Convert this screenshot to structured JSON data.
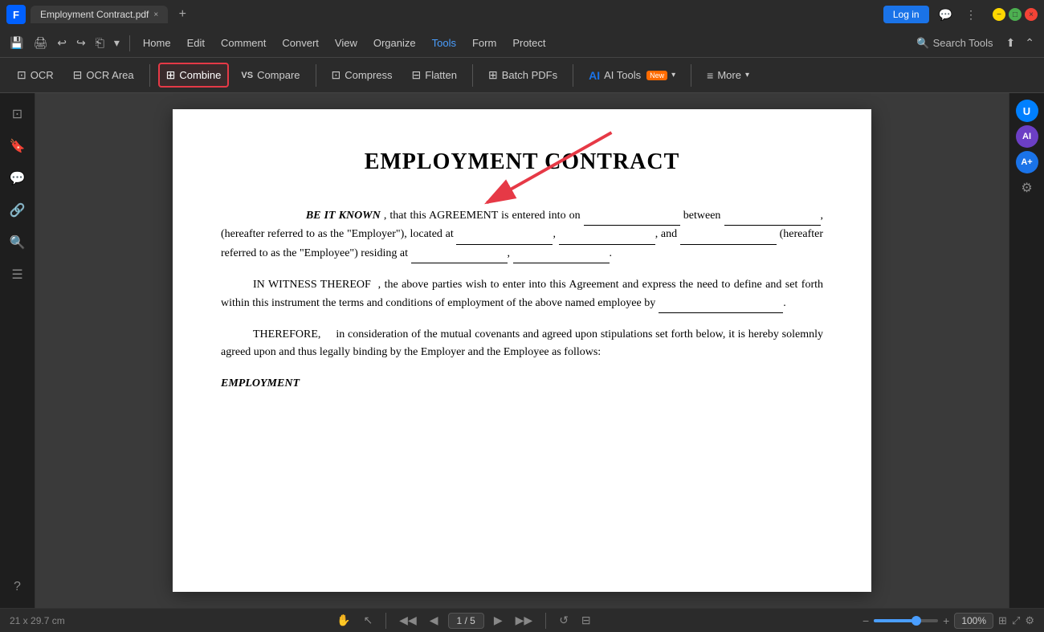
{
  "titleBar": {
    "appLogo": "F",
    "tab": {
      "label": "Employment Contract.pdf",
      "closeBtn": "×"
    },
    "addTabBtn": "+",
    "loginBtn": "Log in",
    "moreMenuIcon": "⋮",
    "minimizeIcon": "—",
    "maximizeIcon": "□",
    "closeIcon": "×"
  },
  "menuBar": {
    "saveIcon": "💾",
    "printIcon": "🖨",
    "undoIcon": "↩",
    "redoIcon": "↪",
    "shareIcon": "⎗",
    "dropdownIcon": "▾",
    "items": [
      "Home",
      "Edit",
      "Comment",
      "Convert",
      "View",
      "Organize",
      "Tools",
      "Form",
      "Protect"
    ],
    "activeItem": "Tools",
    "searchToolsLabel": "Search Tools",
    "searchIcon": "🔍",
    "uploadIcon": "⬆"
  },
  "toolbar": {
    "ocr": {
      "label": "OCR",
      "icon": "⊡"
    },
    "ocrArea": {
      "label": "OCR Area",
      "icon": "⊟"
    },
    "combine": {
      "label": "Combine",
      "icon": "⊞",
      "highlighted": true
    },
    "compare": {
      "label": "Compare",
      "icon": "VS"
    },
    "compress": {
      "label": "Compress",
      "icon": "⊡"
    },
    "flatten": {
      "label": "Flatten",
      "icon": "⊟"
    },
    "batchPDFs": {
      "label": "Batch PDFs",
      "icon": "⊞"
    },
    "aiTools": {
      "label": "AI Tools",
      "icon": "AI",
      "badge": "New"
    },
    "more": {
      "label": "More",
      "icon": "≡"
    }
  },
  "leftSidebar": {
    "icons": [
      "⊡",
      "🔖",
      "💬",
      "🔗",
      "🔍",
      "☰",
      "?"
    ]
  },
  "rightSidebar": {
    "avatarLabel": "U",
    "aiLabel": "AI",
    "atLabel": "A+",
    "adjustIcon": "⚙"
  },
  "pdf": {
    "title": "EMPLOYMENT CONTRACT",
    "paragraph1": {
      "text1": "BE IT KNOWN",
      "text2": ", that this AGREEMENT is entered into on",
      "text3": "between",
      "text4": ", (hereafter referred to as the \"Employer\"), located at",
      "text5": ", and",
      "text6": "(hereafter referred to as the \"Employee\") residing at",
      "text7": "."
    },
    "paragraph2": "IN WITNESS THEREOF , the above parties wish to enter into this Agreement and express the need to define and set forth within this instrument the terms and conditions of employment of the above named employee by",
    "paragraph3": "THEREFORE,   in consideration of the mutual covenants and agreed upon stipulations set forth below, it is hereby solemnly agreed upon and thus legally binding by the Employer and the Employee as follows:",
    "sectionTitle": "EMPLOYMENT"
  },
  "statusBar": {
    "dimensions": "21 x 29.7 cm",
    "handIcon": "✋",
    "arrowIcon": "↖",
    "prevPage": "◀",
    "firstPage": "◀◀",
    "pageIndicator": "1 / 5",
    "nextPage": "▶",
    "lastPage": "▶▶",
    "rotateIcon": "↺",
    "splitIcon": "⊟",
    "zoomOutIcon": "−",
    "zoomInIcon": "+",
    "zoomPct": "100%",
    "fitWidthIcon": "⊞",
    "fullscreenIcon": "⤢",
    "settingsIcon": "⚙"
  }
}
